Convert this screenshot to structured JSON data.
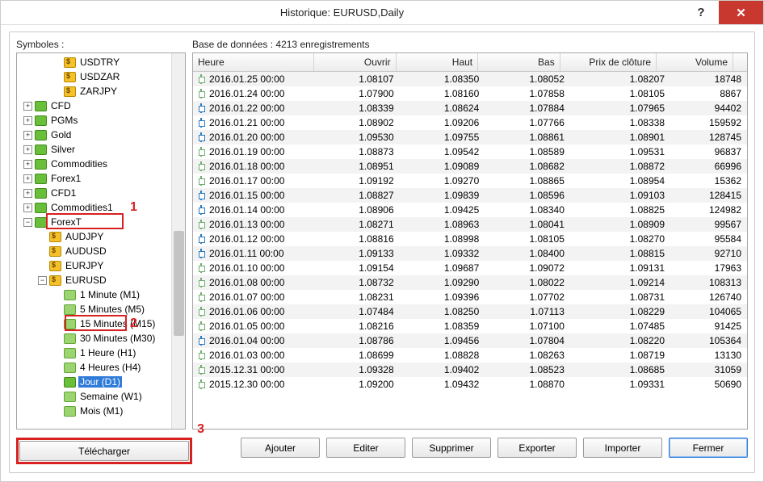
{
  "window": {
    "title": "Historique: EURUSD,Daily",
    "help": "?",
    "close": "✕"
  },
  "left": {
    "label": "Symboles :",
    "pairs_top": [
      "USDTRY",
      "USDZAR",
      "ZARJPY"
    ],
    "folders_top": [
      {
        "name": "CFD"
      },
      {
        "name": "PGMs"
      },
      {
        "name": "Gold"
      },
      {
        "name": "Silver"
      },
      {
        "name": "Commodities"
      },
      {
        "name": "Forex1"
      },
      {
        "name": "CFD1"
      },
      {
        "name": "Commodities1"
      }
    ],
    "forexT": {
      "name": "ForexT",
      "pairs": [
        "AUDJPY",
        "AUDUSD",
        "EURJPY"
      ],
      "selected_pair": "EURUSD",
      "timeframes": [
        "1 Minute (M1)",
        "5 Minutes (M5)",
        "15 Minutes (M15)",
        "30 Minutes (M30)",
        "1 Heure (H1)",
        "4 Heures (H4)"
      ],
      "selected_tf": "Jour (D1)",
      "timeframes_after": [
        "Semaine (W1)",
        "Mois (M1)"
      ]
    }
  },
  "right": {
    "label": "Base de données : 4213 enregistrements",
    "columns": {
      "time": "Heure",
      "open": "Ouvrir",
      "high": "Haut",
      "low": "Bas",
      "close": "Prix de clôture",
      "vol": "Volume"
    },
    "rows": [
      {
        "c": "dn",
        "t": "2016.01.25 00:00",
        "o": "1.08107",
        "h": "1.08350",
        "l": "1.08052",
        "cl": "1.08207",
        "v": "18748"
      },
      {
        "c": "dn",
        "t": "2016.01.24 00:00",
        "o": "1.07900",
        "h": "1.08160",
        "l": "1.07858",
        "cl": "1.08105",
        "v": "8867"
      },
      {
        "c": "up",
        "t": "2016.01.22 00:00",
        "o": "1.08339",
        "h": "1.08624",
        "l": "1.07884",
        "cl": "1.07965",
        "v": "94402"
      },
      {
        "c": "up",
        "t": "2016.01.21 00:00",
        "o": "1.08902",
        "h": "1.09206",
        "l": "1.07766",
        "cl": "1.08338",
        "v": "159592"
      },
      {
        "c": "up",
        "t": "2016.01.20 00:00",
        "o": "1.09530",
        "h": "1.09755",
        "l": "1.08861",
        "cl": "1.08901",
        "v": "128745"
      },
      {
        "c": "dn",
        "t": "2016.01.19 00:00",
        "o": "1.08873",
        "h": "1.09542",
        "l": "1.08589",
        "cl": "1.09531",
        "v": "96837"
      },
      {
        "c": "dn",
        "t": "2016.01.18 00:00",
        "o": "1.08951",
        "h": "1.09089",
        "l": "1.08682",
        "cl": "1.08872",
        "v": "66996"
      },
      {
        "c": "dn",
        "t": "2016.01.17 00:00",
        "o": "1.09192",
        "h": "1.09270",
        "l": "1.08865",
        "cl": "1.08954",
        "v": "15362"
      },
      {
        "c": "up",
        "t": "2016.01.15 00:00",
        "o": "1.08827",
        "h": "1.09839",
        "l": "1.08596",
        "cl": "1.09103",
        "v": "128415"
      },
      {
        "c": "up",
        "t": "2016.01.14 00:00",
        "o": "1.08906",
        "h": "1.09425",
        "l": "1.08340",
        "cl": "1.08825",
        "v": "124982"
      },
      {
        "c": "dn",
        "t": "2016.01.13 00:00",
        "o": "1.08271",
        "h": "1.08963",
        "l": "1.08041",
        "cl": "1.08909",
        "v": "99567"
      },
      {
        "c": "up",
        "t": "2016.01.12 00:00",
        "o": "1.08816",
        "h": "1.08998",
        "l": "1.08105",
        "cl": "1.08270",
        "v": "95584"
      },
      {
        "c": "up",
        "t": "2016.01.11 00:00",
        "o": "1.09133",
        "h": "1.09332",
        "l": "1.08400",
        "cl": "1.08815",
        "v": "92710"
      },
      {
        "c": "dn",
        "t": "2016.01.10 00:00",
        "o": "1.09154",
        "h": "1.09687",
        "l": "1.09072",
        "cl": "1.09131",
        "v": "17963"
      },
      {
        "c": "dn",
        "t": "2016.01.08 00:00",
        "o": "1.08732",
        "h": "1.09290",
        "l": "1.08022",
        "cl": "1.09214",
        "v": "108313"
      },
      {
        "c": "dn",
        "t": "2016.01.07 00:00",
        "o": "1.08231",
        "h": "1.09396",
        "l": "1.07702",
        "cl": "1.08731",
        "v": "126740"
      },
      {
        "c": "dn",
        "t": "2016.01.06 00:00",
        "o": "1.07484",
        "h": "1.08250",
        "l": "1.07113",
        "cl": "1.08229",
        "v": "104065"
      },
      {
        "c": "dn",
        "t": "2016.01.05 00:00",
        "o": "1.08216",
        "h": "1.08359",
        "l": "1.07100",
        "cl": "1.07485",
        "v": "91425"
      },
      {
        "c": "up",
        "t": "2016.01.04 00:00",
        "o": "1.08786",
        "h": "1.09456",
        "l": "1.07804",
        "cl": "1.08220",
        "v": "105364"
      },
      {
        "c": "dn",
        "t": "2016.01.03 00:00",
        "o": "1.08699",
        "h": "1.08828",
        "l": "1.08263",
        "cl": "1.08719",
        "v": "13130"
      },
      {
        "c": "dn",
        "t": "2015.12.31 00:00",
        "o": "1.09328",
        "h": "1.09402",
        "l": "1.08523",
        "cl": "1.08685",
        "v": "31059"
      },
      {
        "c": "dn",
        "t": "2015.12.30 00:00",
        "o": "1.09200",
        "h": "1.09432",
        "l": "1.08870",
        "cl": "1.09331",
        "v": "50690"
      }
    ]
  },
  "buttons": {
    "download": "Télécharger",
    "add": "Ajouter",
    "edit": "Editer",
    "delete": "Supprimer",
    "export": "Exporter",
    "import": "Importer",
    "close": "Fermer"
  },
  "annot": {
    "n1": "1",
    "n2": "2",
    "n3": "3"
  }
}
